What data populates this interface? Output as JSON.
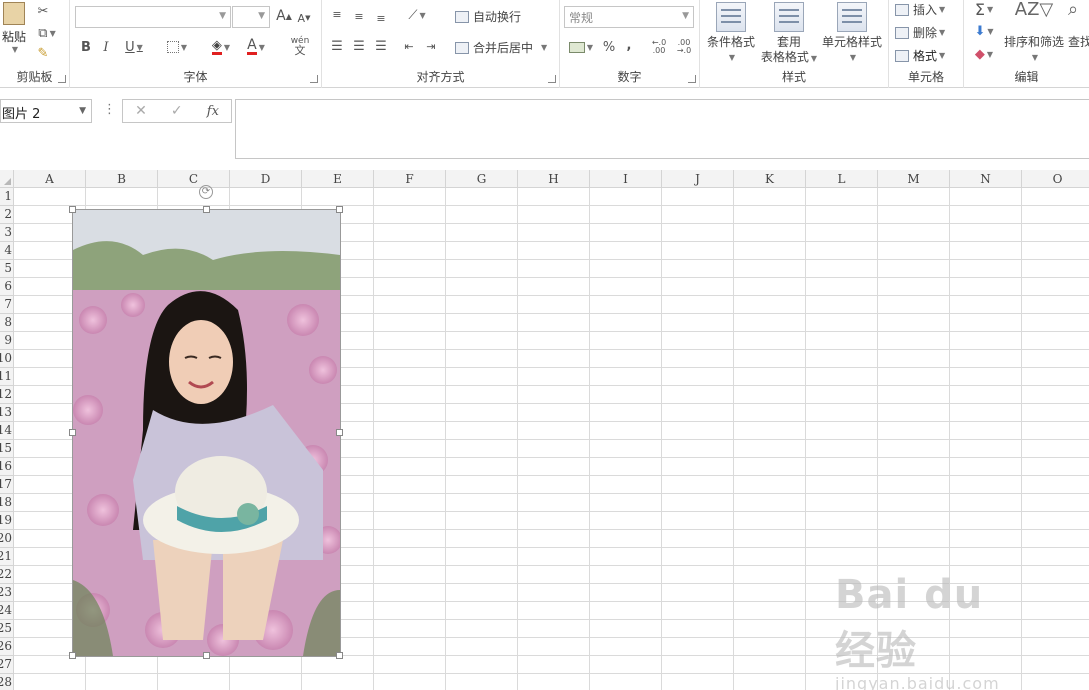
{
  "ribbon": {
    "clipboard": {
      "label": "剪贴板",
      "paste": "粘贴"
    },
    "font": {
      "label": "字体",
      "bold": "B",
      "italic": "I",
      "underline": "U",
      "grow": "A",
      "shrink": "A",
      "color_a": "A",
      "phonetic": "wén"
    },
    "alignment": {
      "label": "对齐方式",
      "wrap": "自动换行",
      "merge": "合并后居中"
    },
    "number": {
      "label": "数字",
      "format_value": "常规",
      "percent": "%",
      "comma": ",",
      "inc_decimal": "←.0 .00",
      "dec_decimal": ".00 →.0"
    },
    "styles": {
      "label": "样式",
      "cond_format": "条件格式",
      "table_format_1": "套用",
      "table_format_2": "表格格式",
      "cell_styles": "单元格样式"
    },
    "cells": {
      "label": "单元格",
      "insert": "插入",
      "delete": "删除",
      "format": "格式"
    },
    "editing": {
      "label": "编辑",
      "sort_filter": "排序和筛选",
      "find": "查找"
    }
  },
  "formula_bar": {
    "name_box": "图片 2",
    "cancel": "✕",
    "enter": "✓",
    "fx": "fx",
    "value": ""
  },
  "grid": {
    "columns": [
      "A",
      "B",
      "C",
      "D",
      "E",
      "F",
      "G",
      "H",
      "I",
      "J",
      "K",
      "L",
      "M",
      "N",
      "O"
    ],
    "rows": [
      "1",
      "2",
      "3",
      "4",
      "5",
      "6",
      "7",
      "8",
      "9",
      "10",
      "11",
      "12",
      "13",
      "14",
      "15",
      "16",
      "17",
      "18",
      "19",
      "20",
      "21",
      "22",
      "23",
      "24",
      "25",
      "26",
      "27",
      "28"
    ]
  },
  "picture": {
    "name": "图片 2",
    "description": "woman-with-hat-in-flower-field"
  },
  "watermark": {
    "logo": "Bai du 经验",
    "url": "jingyan.baidu.com"
  }
}
